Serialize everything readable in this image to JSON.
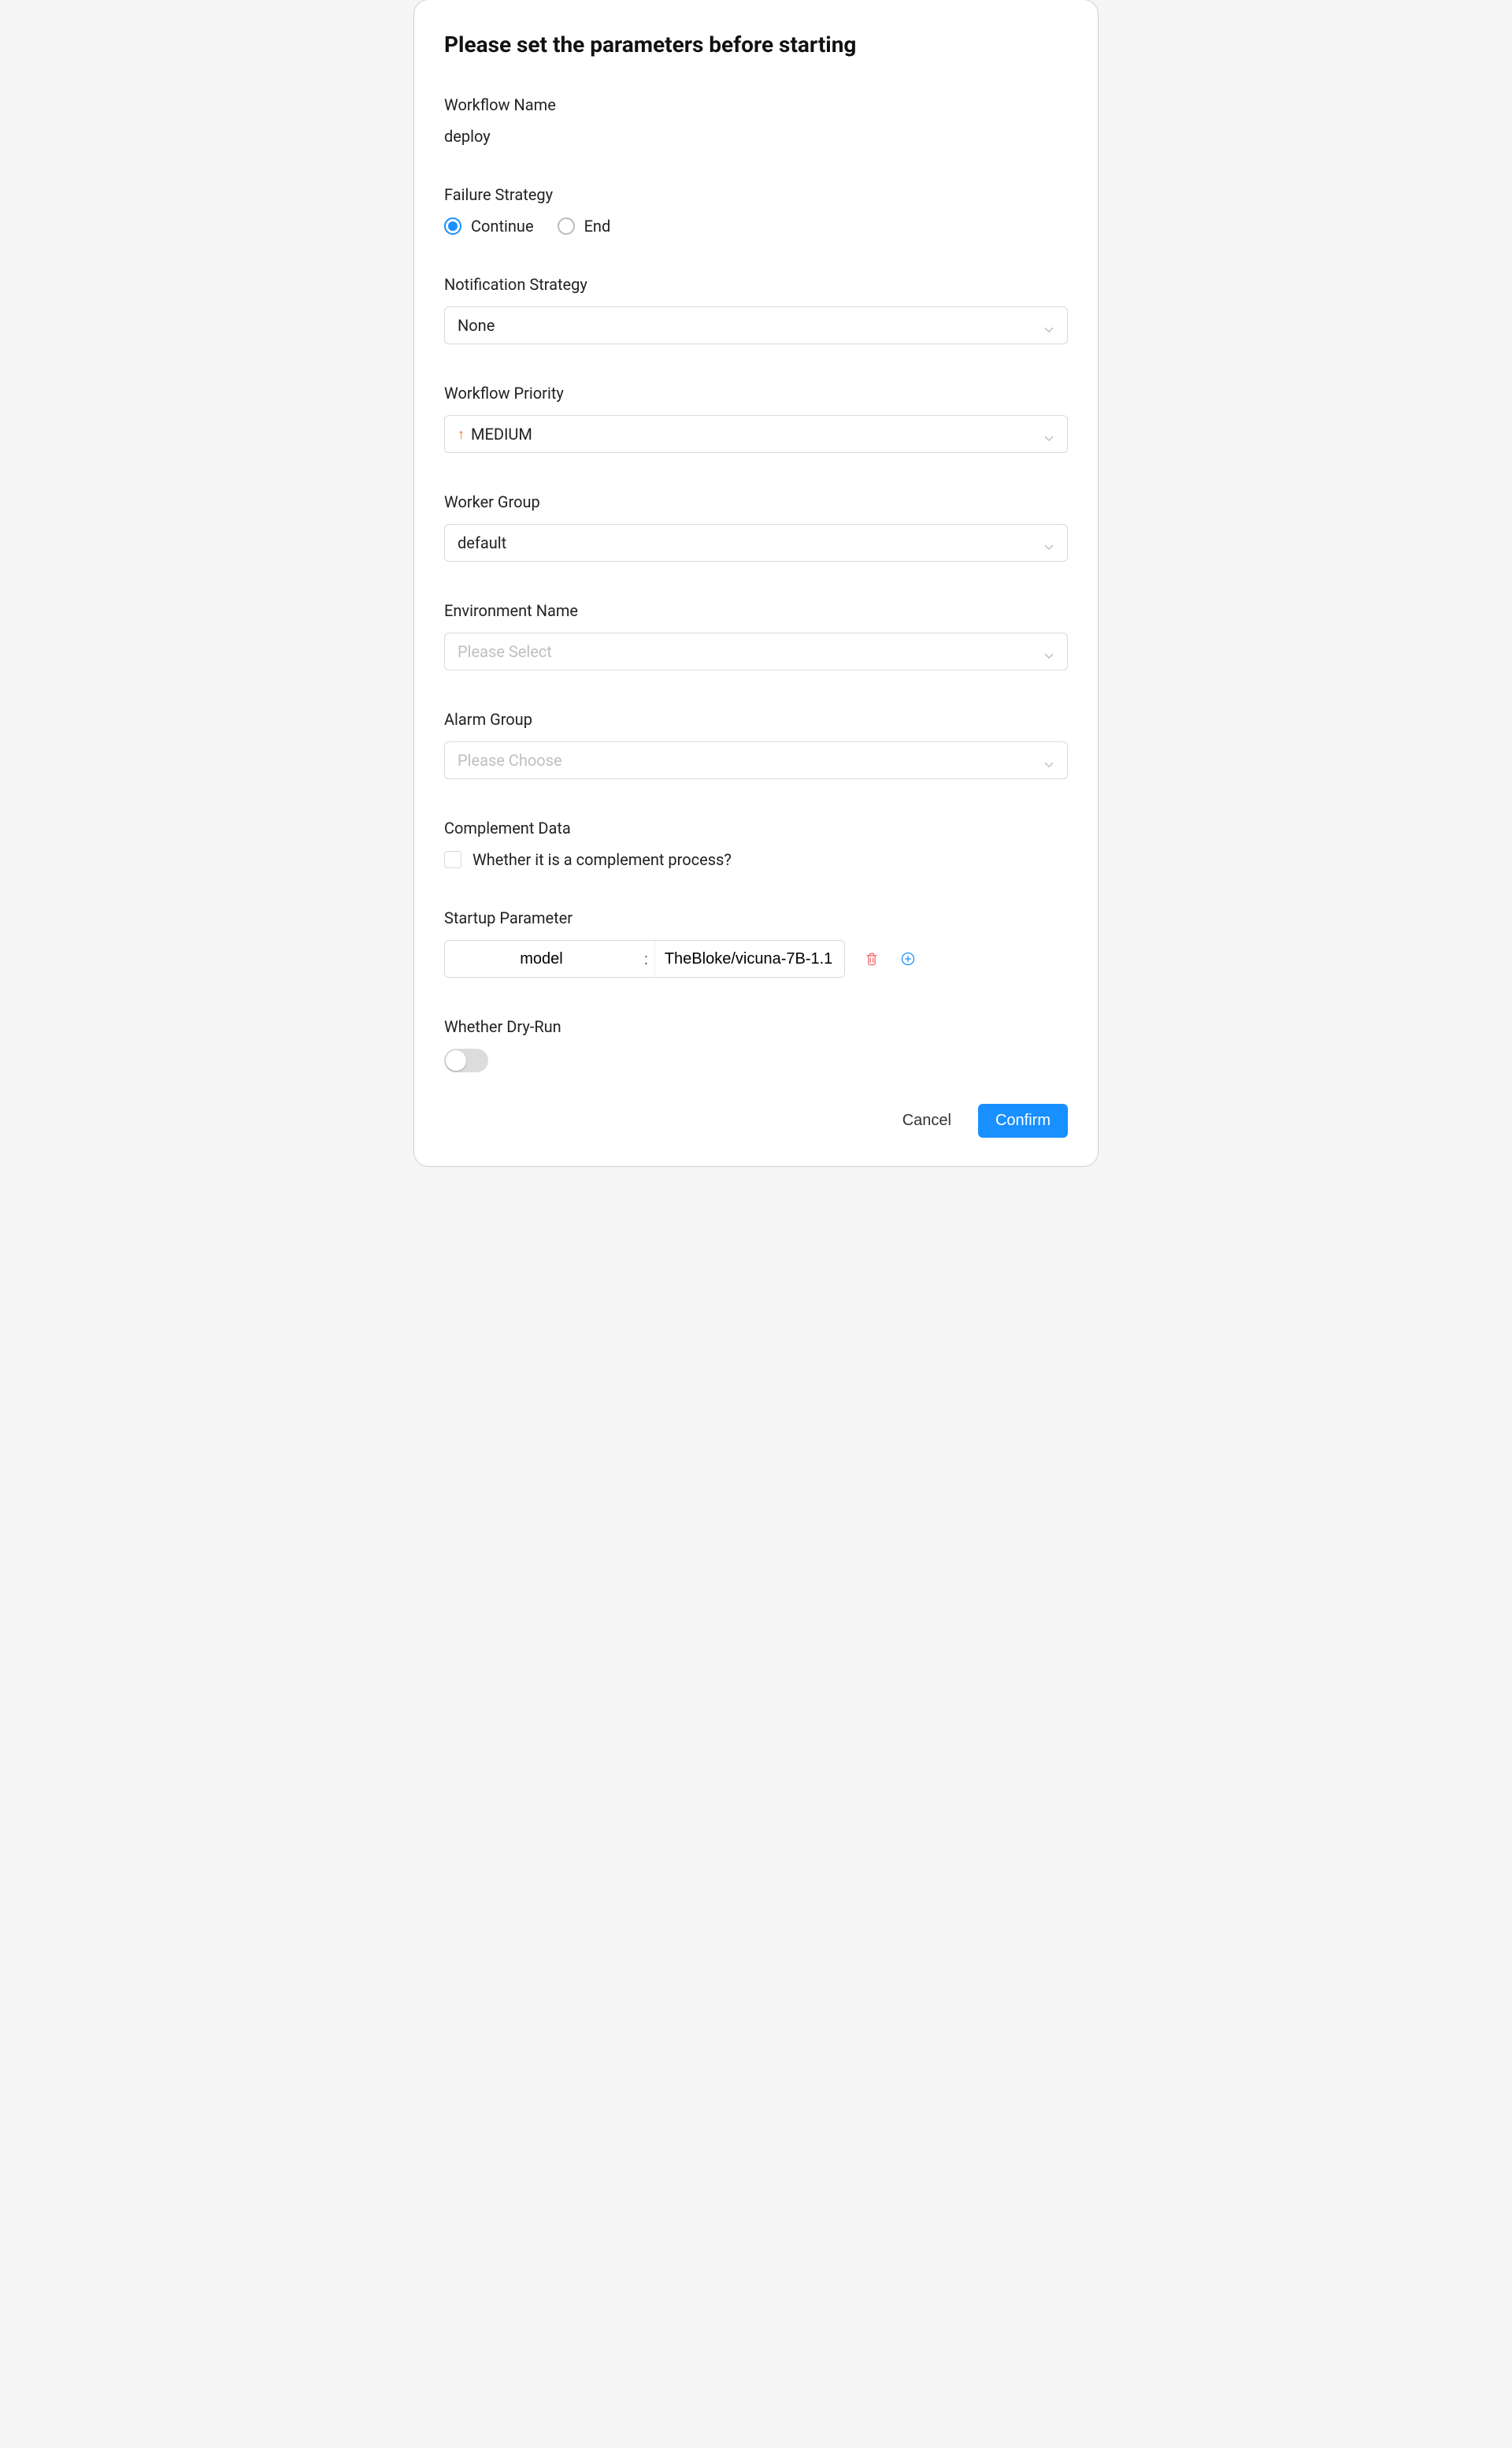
{
  "modal": {
    "title": "Please set the parameters before starting",
    "workflowName": {
      "label": "Workflow Name",
      "value": "deploy"
    },
    "failureStrategy": {
      "label": "Failure Strategy",
      "options": {
        "continue": "Continue",
        "end": "End"
      },
      "selected": "continue"
    },
    "notificationStrategy": {
      "label": "Notification Strategy",
      "value": "None"
    },
    "workflowPriority": {
      "label": "Workflow Priority",
      "value": "MEDIUM"
    },
    "workerGroup": {
      "label": "Worker Group",
      "value": "default"
    },
    "environmentName": {
      "label": "Environment Name",
      "placeholder": "Please Select"
    },
    "alarmGroup": {
      "label": "Alarm Group",
      "placeholder": "Please Choose"
    },
    "complementData": {
      "label": "Complement Data",
      "checkboxLabel": "Whether it is a complement process?",
      "checked": false
    },
    "startupParameter": {
      "label": "Startup Parameter",
      "params": [
        {
          "key": "model",
          "value": "TheBloke/vicuna-7B-1.1"
        }
      ],
      "separator": ":"
    },
    "dryRun": {
      "label": "Whether Dry-Run",
      "enabled": false
    },
    "actions": {
      "cancel": "Cancel",
      "confirm": "Confirm"
    }
  }
}
